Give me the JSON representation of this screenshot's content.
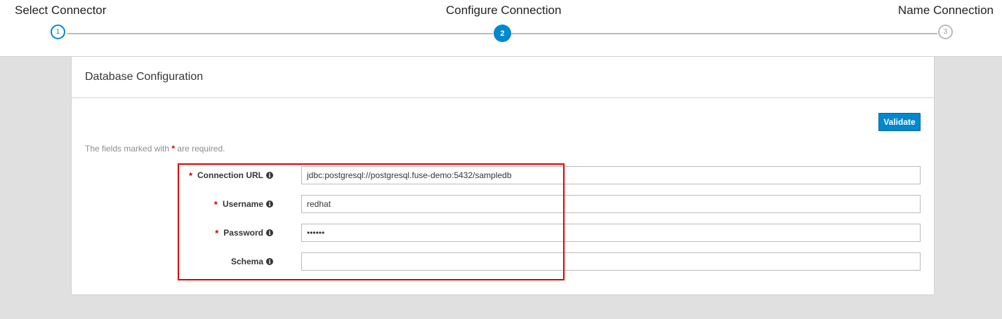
{
  "wizard": {
    "steps": [
      {
        "number": "1",
        "title": "Select Connector",
        "state": "completed"
      },
      {
        "number": "2",
        "title": "Configure Connection",
        "state": "active"
      },
      {
        "number": "3",
        "title": "Name Connection",
        "state": "pending"
      }
    ]
  },
  "card": {
    "title": "Database Configuration",
    "validate_label": "Validate",
    "required_note_prefix": "The fields marked with",
    "required_star": "*",
    "required_note_suffix": "are required.",
    "fields": [
      {
        "label": "Connection URL",
        "required": true,
        "value": "jdbc:postgresql://postgresql.fuse-demo:5432/sampledb",
        "type": "text"
      },
      {
        "label": "Username",
        "required": true,
        "value": "redhat",
        "type": "text"
      },
      {
        "label": "Password",
        "required": true,
        "value": "••••••",
        "type": "password"
      },
      {
        "label": "Schema",
        "required": false,
        "value": "",
        "type": "text"
      }
    ]
  },
  "colors": {
    "accent": "#0088ce",
    "required": "#cc0000",
    "highlight": "#e00000",
    "background": "#e0e0e0"
  },
  "icons": {
    "info": "info-circle-icon"
  }
}
